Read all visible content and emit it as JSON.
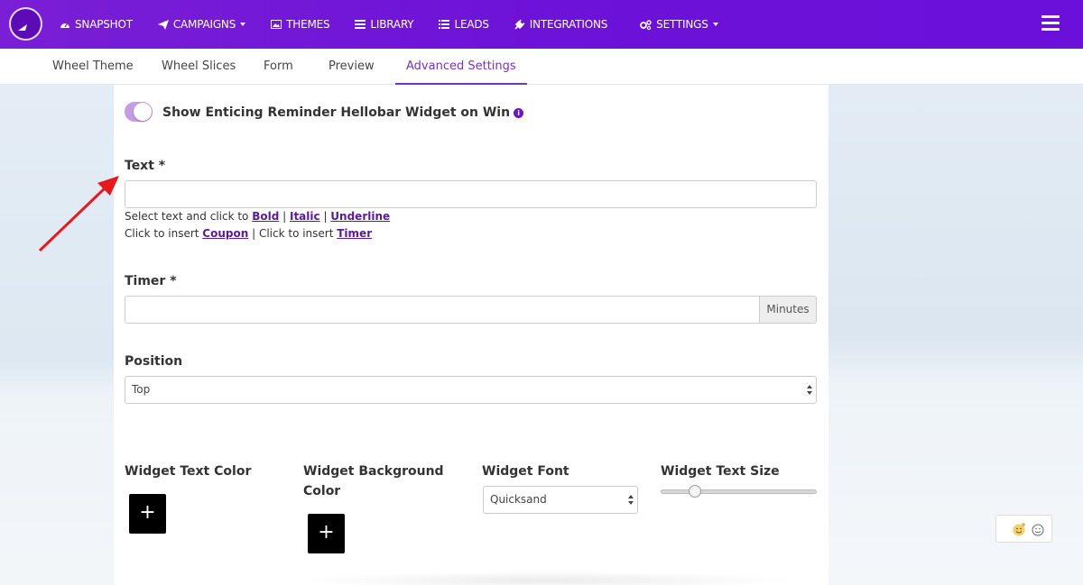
{
  "nav": {
    "items": [
      {
        "label": "SNAPSHOT",
        "icon": "dashboard-icon",
        "caret": false
      },
      {
        "label": "CAMPAIGNS",
        "icon": "paper-plane-icon",
        "caret": true
      },
      {
        "label": "THEMES",
        "icon": "image-icon",
        "caret": false
      },
      {
        "label": "LIBRARY",
        "icon": "list-icon",
        "caret": false
      },
      {
        "label": "LEADS",
        "icon": "list-alt-icon",
        "caret": false
      },
      {
        "label": "INTEGRATIONS",
        "icon": "plug-icon",
        "caret": false
      },
      {
        "label": "SETTINGS",
        "icon": "gears-icon",
        "caret": true
      }
    ]
  },
  "tabs": {
    "wheel_theme": "Wheel Theme",
    "wheel_slices": "Wheel Slices",
    "form": "Form",
    "preview": "Preview",
    "advanced_settings": "Advanced Settings",
    "active": "advanced_settings"
  },
  "form": {
    "toggle_label": "Show Enticing Reminder Hellobar Widget on Win",
    "toggle_on": true,
    "text_label": "Text *",
    "text_value": "",
    "hint1_prefix": "Select text and click to ",
    "hint1_bold": "Bold",
    "hint1_sep1": " | ",
    "hint1_italic": "Italic",
    "hint1_sep2": " | ",
    "hint1_underline": "Underline",
    "hint2_prefix": "Click to insert ",
    "hint2_coupon": "Coupon",
    "hint2_mid": " | Click to insert ",
    "hint2_timer": "Timer",
    "timer_label": "Timer *",
    "timer_value": "",
    "timer_addon": "Minutes",
    "position_label": "Position",
    "position_value": "Top",
    "widget_text_color_label": "Widget Text Color",
    "widget_bg_color_label": "Widget Background Color",
    "widget_font_label": "Widget Font",
    "widget_font_value": "Quicksand",
    "widget_text_size_label": "Widget Text Size",
    "widget_text_size_fraction": 0.22,
    "add_symbol": "+"
  },
  "colors": {
    "brand": "#6d12d8",
    "accent": "#7a30c2",
    "annotation_arrow": "#e8191c"
  }
}
